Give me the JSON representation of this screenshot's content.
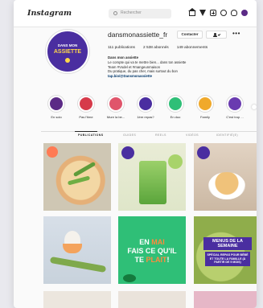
{
  "app": {
    "logo_text": "Instagram"
  },
  "search": {
    "placeholder": "Rechercher"
  },
  "profile": {
    "username": "dansmonassiette_fr",
    "contact_label": "Contacter",
    "avatar_line1": "DANS MON",
    "avatar_line2": "ASSIETTE",
    "stats": {
      "publications": "111 publications",
      "followers": "2 538 abonnés",
      "following": "149 abonnements"
    },
    "bio": {
      "name": "Dans mon assiette",
      "line1": "Le compte qui va te mettre bien... dans ton assiette",
      "line2": "Team #Vodel et #mangeunmaison",
      "line3": "Du pratique, du pas cher, mais surtout du bon",
      "link": "tap.bio/@Dansmonassiette"
    }
  },
  "highlights": [
    {
      "label": "En solo",
      "color": "#5b2a86"
    },
    {
      "label": "Pas l'time",
      "color": "#d63a4a"
    },
    {
      "label": "Mure la be...",
      "color": "#e0556b"
    },
    {
      "label": "1ère repas?",
      "color": "#4a2ea0"
    },
    {
      "label": "En duo",
      "color": "#2fbf77"
    },
    {
      "label": "Family",
      "color": "#f0a92b"
    },
    {
      "label": "C'est trop ...",
      "color": "#6a3bb0"
    }
  ],
  "tabs": [
    {
      "label": "PUBLICATIONS",
      "active": true
    },
    {
      "label": "GUIDES",
      "active": false
    },
    {
      "label": "REELS",
      "active": false
    },
    {
      "label": "VIDÉOS",
      "active": false
    },
    {
      "label": "IDENTIFIÉ(E)",
      "active": false
    }
  ],
  "posts": {
    "p5_text_a": "EN",
    "p5_text_b": "MAI",
    "p5_text_c": "FAIS CE QU'IL",
    "p5_text_d": "TE ",
    "p5_text_e": "PLAIT",
    "p5_text_f": "!",
    "p6_title": "MENUS DE LA SEMAINE",
    "p6_sub": "SPÉCIAL REPAS POUR BÉBÉ ET TOUTE LA FAMILLE (À PARTIR DE 9 MOIS)"
  }
}
